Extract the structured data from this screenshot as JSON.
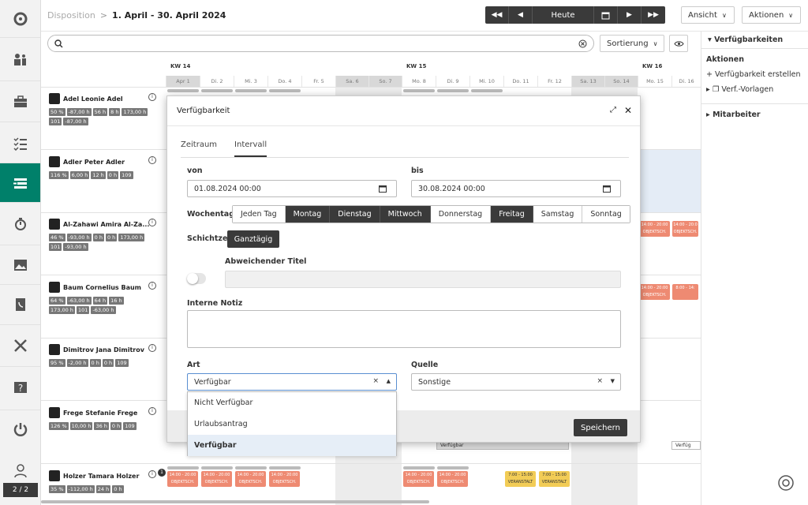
{
  "breadcrumb": {
    "root": "Disposition",
    "separator": ">",
    "current": "1. April - 30. April 2024"
  },
  "date_nav": {
    "today": "Heute"
  },
  "top_buttons": {
    "view": "Ansicht",
    "actions": "Aktionen"
  },
  "search": {
    "placeholder": ""
  },
  "sort": {
    "label": "Sortierung"
  },
  "nav": {
    "page": "2 / 2"
  },
  "right_panel": {
    "header": "Verfügbarkeiten",
    "actions_title": "Aktionen",
    "create": "Verfügbarkeit erstellen",
    "templates": "Verf.-Vorlagen",
    "employees": "Mitarbeiter"
  },
  "weeks": [
    "KW 14",
    "KW 15",
    "KW 16"
  ],
  "days": [
    "Apr 1",
    "Di. 2",
    "Mi. 3",
    "Do. 4",
    "Fr. 5",
    "Sa. 6",
    "So. 7",
    "Mo. 8",
    "Di. 9",
    "Mi. 10",
    "Do. 11",
    "Fr. 12",
    "Sa. 13",
    "So. 14",
    "Mo. 15",
    "Di. 16"
  ],
  "employees": [
    {
      "name": "Adel Leonie Adel",
      "tags": [
        "50 %",
        "-87,00 h",
        "56 h",
        "8 h",
        "173,00 h",
        "101",
        "-87,00 h"
      ]
    },
    {
      "name": "Adler Peter Adler",
      "tags": [
        "116 %",
        "6,00 h",
        "12 h",
        "0 h",
        "109"
      ]
    },
    {
      "name": "Al-Zahawi Amira Al-Za...",
      "tags": [
        "46 %",
        "-93,00 h",
        "0 h",
        "0 h",
        "173,00 h",
        "101",
        "-93,00 h"
      ]
    },
    {
      "name": "Baum Cornelius Baum",
      "tags": [
        "64 %",
        "-63,00 h",
        "64 h",
        "16 h",
        "173,00 h",
        "101",
        "-63,00 h"
      ]
    },
    {
      "name": "Dimitrov Jana Dimitrov",
      "tags": [
        "95 %",
        "-2,00 h",
        "0 h",
        "0 h",
        "109"
      ]
    },
    {
      "name": "Frege Stefanie Frege",
      "tags": [
        "126 %",
        "10,00 h",
        "36 h",
        "0 h",
        "109"
      ]
    },
    {
      "name": "Holzer Tamara Holzer",
      "tags": [
        "35 %",
        "-112,00 h",
        "24 h",
        "0 h"
      ]
    }
  ],
  "shifts": {
    "red": [
      "14:00 - 20:00 OBJEKTSCH."
    ],
    "yellow": [
      "7:00 - 15:00 VERANSTALT"
    ],
    "partial_red": [
      "14:00 - 20:0 OBJEKTSCH.",
      "8:00 - 14:"
    ],
    "avail": "Verfügbar",
    "avail_short": "Verfüg"
  },
  "modal": {
    "title": "Verfügbarkeit",
    "tabs": [
      "Zeitraum",
      "Intervall"
    ],
    "from_label": "von",
    "from_value": "01.08.2024 00:00",
    "to_label": "bis",
    "to_value": "30.08.2024 00:00",
    "weekdays_label": "Wochentage",
    "weekdays": [
      {
        "label": "Jeden Tag",
        "on": false
      },
      {
        "label": "Montag",
        "on": true
      },
      {
        "label": "Dienstag",
        "on": true
      },
      {
        "label": "Mittwoch",
        "on": true
      },
      {
        "label": "Donnerstag",
        "on": false
      },
      {
        "label": "Freitag",
        "on": true
      },
      {
        "label": "Samstag",
        "on": false
      },
      {
        "label": "Sonntag",
        "on": false
      }
    ],
    "shift_label": "Schichtzeit",
    "all_day": "Ganztägig",
    "alt_title_label": "Abweichender Titel",
    "note_label": "Interne Notiz",
    "type_label": "Art",
    "type_value": "Verfügbar",
    "source_label": "Quelle",
    "source_value": "Sonstige",
    "save": "Speichern",
    "type_options": [
      "Nicht Verfügbar",
      "Urlaubsantrag",
      "Verfügbar"
    ],
    "badge": "1"
  }
}
